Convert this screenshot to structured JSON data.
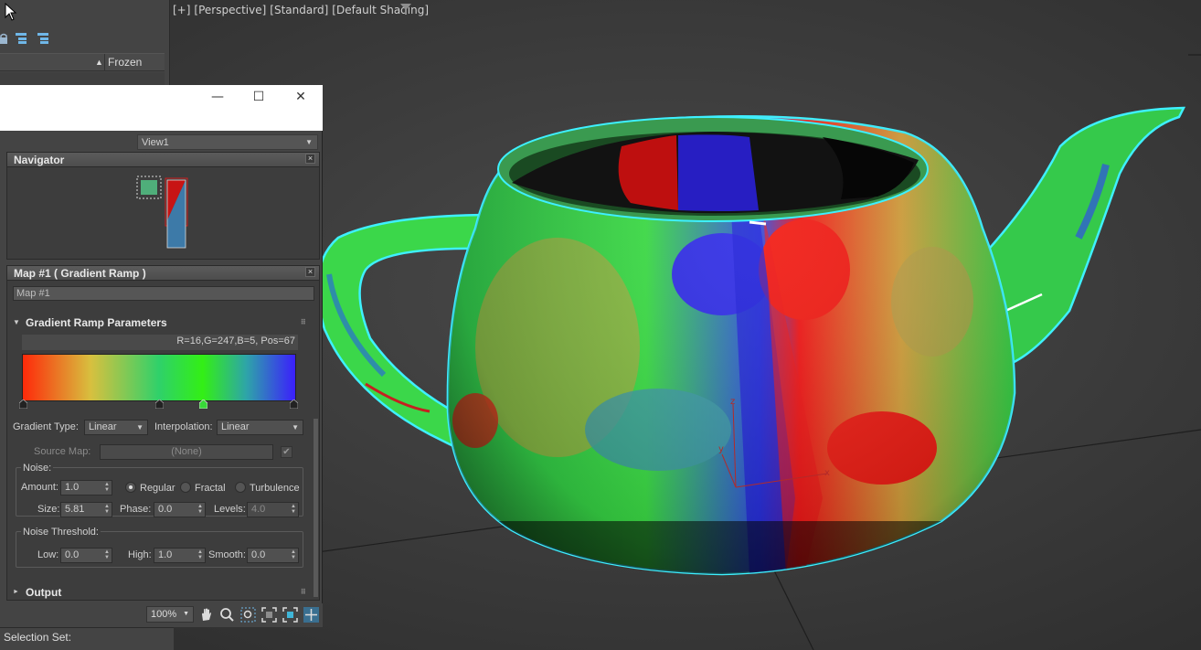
{
  "viewport": {
    "labels": [
      "[+]",
      "[Perspective]",
      "[Standard]",
      "[Default Shading]"
    ]
  },
  "scene_explorer": {
    "column_frozen": "Frozen"
  },
  "material_editor": {
    "window_controls": {
      "minimize": "—",
      "maximize": "☐",
      "close": "✕"
    },
    "view_dropdown": "View1",
    "navigator": {
      "title": "Navigator"
    },
    "map_panel": {
      "title": "Map #1  ( Gradient Ramp )",
      "map_name": "Map #1",
      "rollout_title": "Gradient Ramp Parameters",
      "flag_status": "R=16,G=247,B=5, Pos=67",
      "gradient_type_label": "Gradient Type:",
      "gradient_type_value": "Linear",
      "interpolation_label": "Interpolation:",
      "interpolation_value": "Linear",
      "source_map_label": "Source Map:",
      "source_map_value": "(None)",
      "noise_label": "Noise:",
      "amount_label": "Amount:",
      "amount_value": "1.0",
      "radio_regular": "Regular",
      "radio_fractal": "Fractal",
      "radio_turbulence": "Turbulence",
      "size_label": "Size:",
      "size_value": "5.81",
      "phase_label": "Phase:",
      "phase_value": "0.0",
      "levels_label": "Levels:",
      "levels_value": "4.0",
      "noise_threshold_label": "Noise Threshold:",
      "low_label": "Low:",
      "low_value": "0.0",
      "high_label": "High:",
      "high_value": "1.0",
      "smooth_label": "Smooth:",
      "smooth_value": "0.0",
      "output_title": "Output"
    },
    "zoom": "100%"
  },
  "status": {
    "selection_set": "Selection Set:"
  },
  "colors": {
    "viewport_bg": "#3a3a3a",
    "panel_bg": "#444444",
    "selection_outline": "#3ef0ff",
    "axis_x": "#c03030",
    "axis_y": "#c03030",
    "axis_z": "#c03030"
  },
  "icons": [
    "filter-icon",
    "cursor-icon",
    "pan-hand-icon",
    "zoom-icon",
    "zoom-region-icon",
    "zoom-extents-icon",
    "zoom-extents-selected-icon",
    "pan-icon",
    "lock-icon",
    "hierarchy-icon"
  ]
}
